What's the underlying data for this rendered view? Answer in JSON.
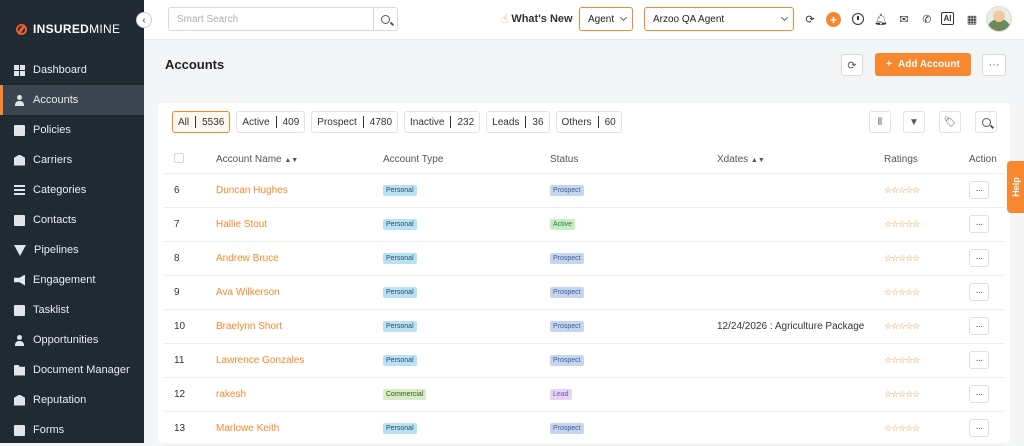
{
  "brand": {
    "part1": "INSURED",
    "part2": "MINE"
  },
  "sidebar": {
    "items": [
      {
        "label": "Dashboard",
        "icon": "dashboard-icon"
      },
      {
        "label": "Accounts",
        "icon": "accounts-icon"
      },
      {
        "label": "Policies",
        "icon": "policies-icon"
      },
      {
        "label": "Carriers",
        "icon": "carriers-icon"
      },
      {
        "label": "Categories",
        "icon": "categories-icon"
      },
      {
        "label": "Contacts",
        "icon": "contacts-icon"
      },
      {
        "label": "Pipelines",
        "icon": "pipelines-icon"
      },
      {
        "label": "Engagement",
        "icon": "engagement-icon"
      },
      {
        "label": "Tasklist",
        "icon": "tasklist-icon"
      },
      {
        "label": "Opportunities",
        "icon": "opportunities-icon"
      },
      {
        "label": "Document Manager",
        "icon": "folder-icon"
      },
      {
        "label": "Reputation",
        "icon": "reputation-icon"
      },
      {
        "label": "Forms",
        "icon": "forms-icon"
      }
    ],
    "active_index": 1
  },
  "topbar": {
    "search_placeholder": "Smart Search",
    "whats_new": "What's New",
    "role_select": "Agent",
    "agent_select": "Arzoo QA Agent"
  },
  "page": {
    "title": "Accounts",
    "add_button": "Add Account",
    "help": "Help"
  },
  "filters": [
    {
      "label": "All",
      "count": "5536"
    },
    {
      "label": "Active",
      "count": "409"
    },
    {
      "label": "Prospect",
      "count": "4780"
    },
    {
      "label": "Inactive",
      "count": "232"
    },
    {
      "label": "Leads",
      "count": "36"
    },
    {
      "label": "Others",
      "count": "60"
    }
  ],
  "table": {
    "headers": {
      "name": "Account Name",
      "type": "Account Type",
      "status": "Status",
      "xdates": "Xdates",
      "ratings": "Ratings",
      "action": "Action"
    },
    "rows": [
      {
        "num": "6",
        "name": "Duncan Hughes",
        "type": "Personal",
        "status": "Prospect",
        "xdates": "",
        "stars": "☆☆☆☆☆"
      },
      {
        "num": "7",
        "name": "Hallie Stout",
        "type": "Personal",
        "status": "Active",
        "xdates": "",
        "stars": "☆☆☆☆☆"
      },
      {
        "num": "8",
        "name": "Andrew Bruce",
        "type": "Personal",
        "status": "Prospect",
        "xdates": "",
        "stars": "☆☆☆☆☆"
      },
      {
        "num": "9",
        "name": "Ava Wilkerson",
        "type": "Personal",
        "status": "Prospect",
        "xdates": "",
        "stars": "☆☆☆☆☆"
      },
      {
        "num": "10",
        "name": "Braelynn Short",
        "type": "Personal",
        "status": "Prospect",
        "xdates": "12/24/2026 : Agriculture Package",
        "stars": "☆☆☆☆☆"
      },
      {
        "num": "11",
        "name": "Lawrence Gonzales",
        "type": "Personal",
        "status": "Prospect",
        "xdates": "",
        "stars": "☆☆☆☆☆"
      },
      {
        "num": "12",
        "name": "rakesh",
        "type": "Commercial",
        "status": "Lead",
        "xdates": "",
        "stars": "☆☆☆☆☆"
      },
      {
        "num": "13",
        "name": "Marlowe Keith",
        "type": "Personal",
        "status": "Prospect",
        "xdates": "",
        "stars": "☆☆☆☆☆"
      }
    ]
  },
  "colors": {
    "accent": "#f7882f",
    "sidebar": "#1f2a33"
  }
}
